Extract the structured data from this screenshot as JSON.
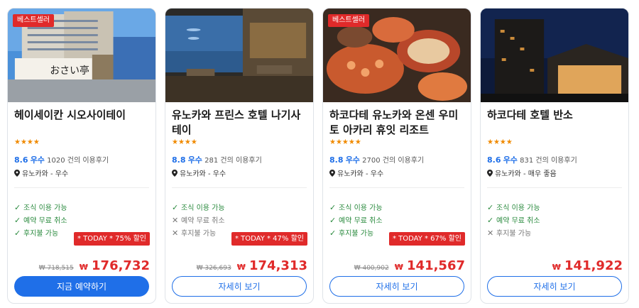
{
  "cards": [
    {
      "badge": "베스트셀러",
      "name": "헤이세이칸 시오사이테이",
      "stars": "★★★★",
      "score": "8.6",
      "grade": "우수",
      "reviews": "1020 건의 이용후기",
      "location": "유노카와 - 우수",
      "amenities": [
        {
          "label": "조식 이용 가능",
          "available": true
        },
        {
          "label": "예약 무료 취소",
          "available": true
        },
        {
          "label": "후지불 가능",
          "available": true
        }
      ],
      "discount": "* TODAY * 75% 할인",
      "original_price": "₩ 718,515",
      "currency": "₩",
      "price": "176,732",
      "button": "지금 예약하기",
      "button_style": "primary"
    },
    {
      "badge": "",
      "name": "유노카와 프린스 호텔 나기사테이",
      "stars": "★★★★",
      "score": "8.8",
      "grade": "우수",
      "reviews": "281 건의 이용후기",
      "location": "유노카와 - 우수",
      "amenities": [
        {
          "label": "조식 이용 가능",
          "available": true
        },
        {
          "label": "예약 무료 취소",
          "available": false
        },
        {
          "label": "후지불 가능",
          "available": false
        }
      ],
      "discount": "* TODAY * 47% 할인",
      "original_price": "₩ 326,693",
      "currency": "₩",
      "price": "174,313",
      "button": "자세히 보기",
      "button_style": "outline"
    },
    {
      "badge": "베스트셀러",
      "name": "하코다테 유노카와 온센 우미 토 아카리 휴잇 리조트",
      "stars": "★★★★★",
      "score": "8.8",
      "grade": "우수",
      "reviews": "2700 건의 이용후기",
      "location": "유노카와 - 우수",
      "amenities": [
        {
          "label": "조식 이용 가능",
          "available": true
        },
        {
          "label": "예약 무료 취소",
          "available": true
        },
        {
          "label": "후지불 가능",
          "available": true
        }
      ],
      "discount": "* TODAY * 67% 할인",
      "original_price": "₩ 400,902",
      "currency": "₩",
      "price": "141,567",
      "button": "자세히 보기",
      "button_style": "outline"
    },
    {
      "badge": "",
      "name": "하코다테 호텔 반소",
      "stars": "★★★★",
      "score": "8.6",
      "grade": "우수",
      "reviews": "831 건의 이용후기",
      "location": "유노카와 - 매우 좋음",
      "amenities": [
        {
          "label": "조식 이용 가능",
          "available": true
        },
        {
          "label": "예약 무료 취소",
          "available": true
        },
        {
          "label": "후지불 가능",
          "available": false
        }
      ],
      "discount": "",
      "original_price": "",
      "currency": "₩",
      "price": "141,922",
      "button": "자세히 보기",
      "button_style": "outline"
    }
  ],
  "colors": {
    "accent": "#1f6fe8",
    "sale_red": "#e02a2a",
    "star_orange": "#f08a00",
    "available_green": "#2a8a3e"
  }
}
